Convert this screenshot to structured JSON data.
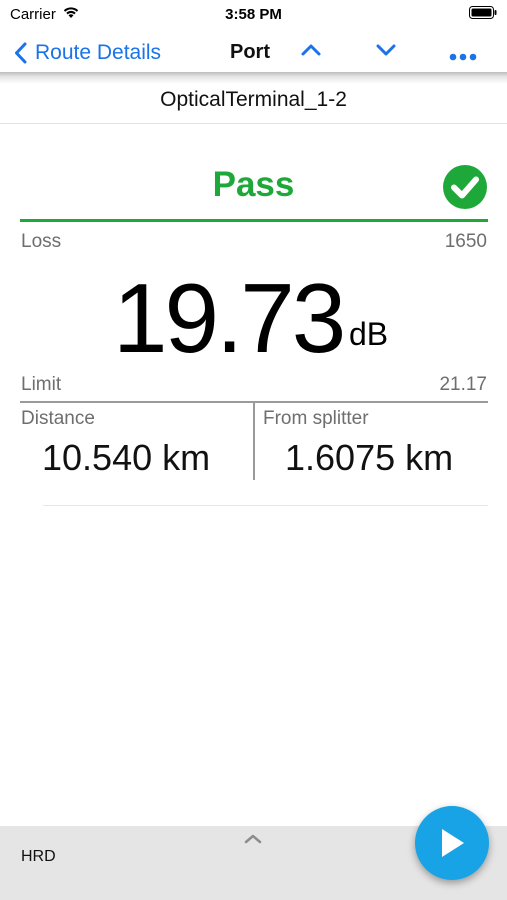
{
  "status_bar": {
    "carrier": "Carrier",
    "time": "3:58 PM"
  },
  "nav": {
    "back_label": "Route Details",
    "title": "Port",
    "icons": [
      "chevron-left-icon",
      "chevron-up-icon",
      "chevron-down-icon",
      "more-icon"
    ]
  },
  "terminal": {
    "name": "OpticalTerminal_1-2"
  },
  "result": {
    "status": "Pass",
    "status_color": "#1fa83a",
    "icon": "check-circle-icon"
  },
  "loss": {
    "label": "Loss",
    "wavelength": "1650",
    "value": "19.73",
    "unit": "dB"
  },
  "limit": {
    "label": "Limit",
    "value": "21.17"
  },
  "distance": {
    "label": "Distance",
    "value": "10.540 km"
  },
  "from_splitter": {
    "label": "From splitter",
    "value": "1.6075 km"
  },
  "bottom_bar": {
    "label": "HRD",
    "play_icon": "play-icon",
    "accent_color": "#17a3e6"
  }
}
